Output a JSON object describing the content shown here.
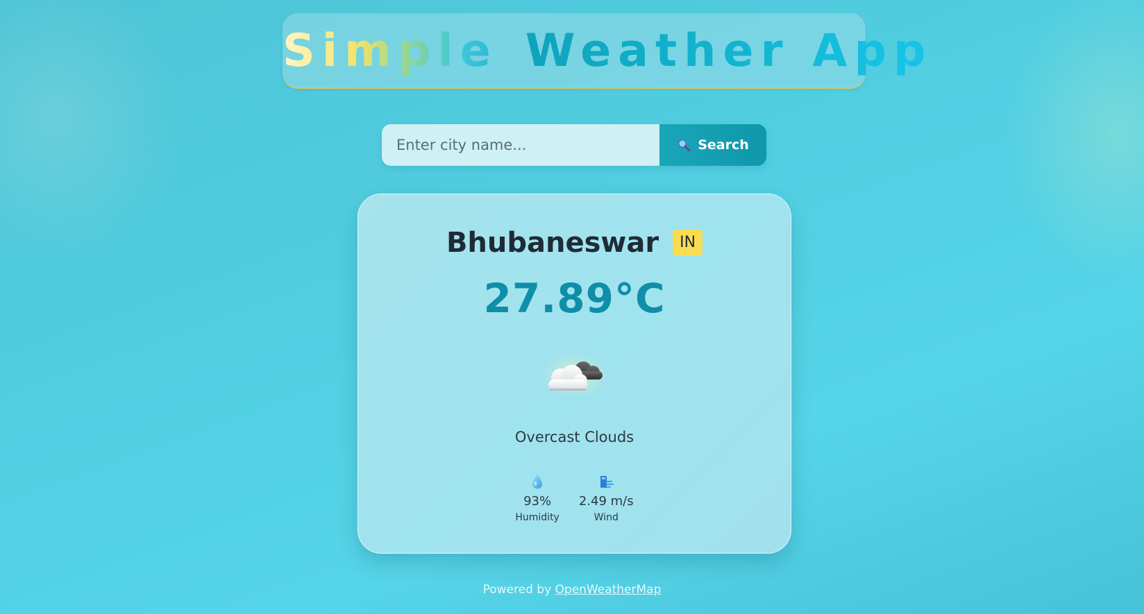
{
  "header": {
    "title_word1": "Simple",
    "title_word2": "Weather App"
  },
  "search": {
    "placeholder": "Enter city name...",
    "value": "",
    "button_label": "Search",
    "button_icon": "magnifier-icon"
  },
  "weather": {
    "city": "Bhubaneswar",
    "country": "IN",
    "temperature": "27.89°C",
    "icon": "cloud-icon",
    "description": "Overcast Clouds",
    "stats": [
      {
        "icon": "droplet-icon",
        "value": "93%",
        "label": "Humidity"
      },
      {
        "icon": "wind-icon",
        "value": "2.49 m/s",
        "label": "Wind"
      }
    ]
  },
  "footer": {
    "text": "Powered by",
    "link_label": "OpenWeatherMap"
  },
  "colors": {
    "accent": "#0f8ea8",
    "button": "#1aa6b8",
    "badge": "#f9dc50"
  }
}
